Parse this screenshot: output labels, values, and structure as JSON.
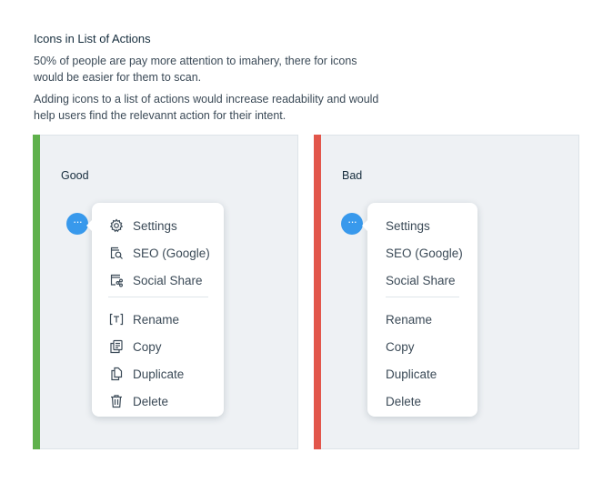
{
  "heading": "Icons in List of Actions",
  "paragraph1": "50% of people are pay more attention to imahery, there for icons would be easier for them to scan.",
  "paragraph2": "Adding icons to a list of actions would increase readability and would help users find the relevannt action for their intent.",
  "colors": {
    "good_bar": "#5fb14c",
    "bad_bar": "#e2564b",
    "accent": "#3899ec"
  },
  "good": {
    "label": "Good",
    "more_button": "···",
    "items": [
      {
        "label": "Settings",
        "icon": "settings-icon"
      },
      {
        "label": "SEO (Google)",
        "icon": "seo-icon"
      },
      {
        "label": "Social Share",
        "icon": "social-share-icon"
      },
      {
        "label": "Rename",
        "icon": "rename-icon"
      },
      {
        "label": "Copy",
        "icon": "copy-icon"
      },
      {
        "label": "Duplicate",
        "icon": "duplicate-icon"
      },
      {
        "label": "Delete",
        "icon": "delete-icon"
      }
    ]
  },
  "bad": {
    "label": "Bad",
    "more_button": "···",
    "items": [
      {
        "label": "Settings"
      },
      {
        "label": "SEO (Google)"
      },
      {
        "label": "Social Share"
      },
      {
        "label": "Rename"
      },
      {
        "label": "Copy"
      },
      {
        "label": "Duplicate"
      },
      {
        "label": "Delete"
      }
    ]
  }
}
